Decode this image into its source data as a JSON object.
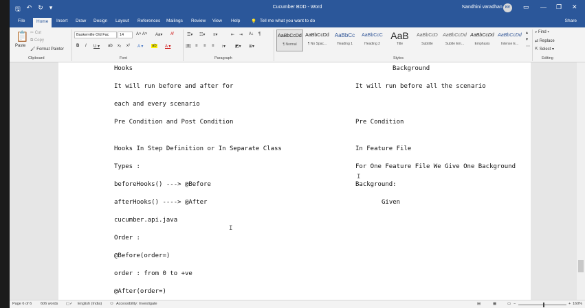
{
  "titlebar": {
    "doc_title": "Cucumber BDD - Word",
    "user": "Nandhini varadhan",
    "avatar": "NV"
  },
  "tabs": [
    "File",
    "Home",
    "Insert",
    "Draw",
    "Design",
    "Layout",
    "References",
    "Mailings",
    "Review",
    "View",
    "Help"
  ],
  "tell_me": "Tell me what you want to do",
  "share": "Share",
  "ribbon": {
    "clipboard": {
      "paste": "Paste",
      "cut": "Cut",
      "copy": "Copy",
      "format_painter": "Format Painter",
      "label": "Clipboard"
    },
    "font": {
      "family": "Baskerville Old Fac",
      "size": "14",
      "label": "Font"
    },
    "paragraph": {
      "label": "Paragraph"
    },
    "styles_label": "Styles",
    "styles": [
      {
        "preview": "AaBbCcDd",
        "name": "¶ Normal"
      },
      {
        "preview": "AaBbCcDd",
        "name": "¶ No Spac..."
      },
      {
        "preview": "AaBbCc",
        "name": "Heading 1"
      },
      {
        "preview": "AaBbCcC",
        "name": "Heading 2"
      },
      {
        "preview": "AaB",
        "name": "Title"
      },
      {
        "preview": "AaBbCcD",
        "name": "Subtitle"
      },
      {
        "preview": "AaBbCcDd",
        "name": "Subtle Em..."
      },
      {
        "preview": "AaBbCcDd",
        "name": "Emphasis"
      },
      {
        "preview": "AaBbCcDd",
        "name": "Intense E..."
      }
    ],
    "editing": {
      "find": "Find",
      "replace": "Replace",
      "select": "Select",
      "label": "Editing"
    }
  },
  "document": {
    "left": [
      "Hooks",
      "It will run before and after for",
      "each and every scenario",
      "Pre Condition and Post Condition",
      "Hooks In Step Definition or In Separate Class",
      "Types :",
      "beforeHooks() ---> @Before",
      "afterHooks() ----> @After",
      "cucumber.api.java",
      "Order :",
      "@Before(order=)",
      "order : from 0 to +ve",
      "@After(order=)"
    ],
    "right": [
      "Background",
      "It will run before all the scenario",
      "Pre Condition",
      "In Feature File",
      "For One Feature File We Give One Background",
      "Background:",
      "Given"
    ]
  },
  "status": {
    "page": "Page 6 of 6",
    "words": "606 words",
    "language": "English (India)",
    "accessibility": "Accessibility: Investigate",
    "zoom": "160%"
  }
}
